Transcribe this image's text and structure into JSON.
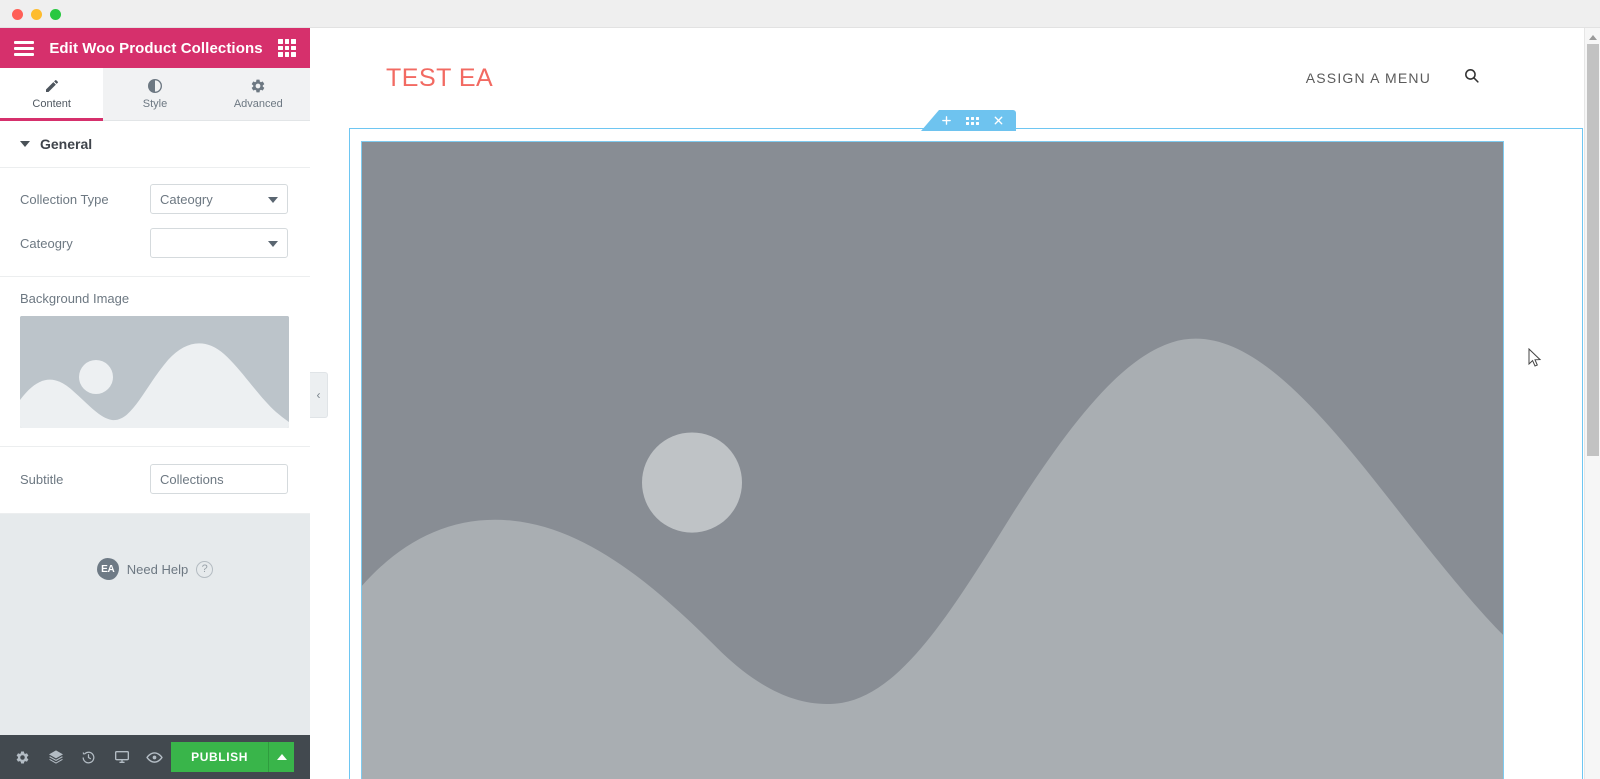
{
  "window": {
    "traffic_lights": [
      "close",
      "minimize",
      "maximize"
    ]
  },
  "panel": {
    "header": {
      "title": "Edit Woo Product Collections",
      "menu_icon": "hamburger-icon",
      "widgets_icon": "grid-icon",
      "accent_color": "#d6306c"
    },
    "tabs": [
      {
        "label": "Content",
        "icon": "pencil-icon",
        "active": true
      },
      {
        "label": "Style",
        "icon": "contrast-icon",
        "active": false
      },
      {
        "label": "Advanced",
        "icon": "gear-icon",
        "active": false
      }
    ],
    "section": {
      "label": "General",
      "expanded": true
    },
    "controls": {
      "collection_type": {
        "label": "Collection Type",
        "value": "Cateogry",
        "options": [
          "Cateogry"
        ]
      },
      "category": {
        "label": "Cateogry",
        "value": "",
        "options": []
      },
      "background_image": {
        "label": "Background Image",
        "placeholder_type": "image-placeholder"
      },
      "subtitle": {
        "label": "Subtitle",
        "value": "Collections",
        "placeholder": ""
      }
    },
    "need_help": {
      "badge": "EA",
      "label": "Need Help",
      "help_icon": "question-mark-icon"
    },
    "footer": {
      "icons": [
        "gear-icon",
        "layers-icon",
        "history-icon",
        "responsive-desktop-icon",
        "preview-eye-icon"
      ],
      "publish_label": "PUBLISH",
      "publish_color": "#39b54a",
      "publish_caret": "chevron-up-icon"
    },
    "collapse_handle": "‹"
  },
  "canvas": {
    "site": {
      "logo": "TEST EA",
      "logo_color": "#f26a62",
      "nav_label": "ASSIGN A MENU",
      "search_icon": "search-icon"
    },
    "section_toolbar": {
      "add_icon": "plus-icon",
      "drag_icon": "drag-handle-icon",
      "close_icon": "close-icon",
      "color": "#6ec3ef"
    },
    "placeholder_image": {
      "background_color": "#888d94",
      "wave_color": "#a9aeb2",
      "circle_color": "#bfc3c6"
    },
    "outline_color": "#6ec6f2"
  },
  "scrollbar": {
    "arrow_up": "chevron-up-icon",
    "thumb_color": "#c2c2c2"
  }
}
